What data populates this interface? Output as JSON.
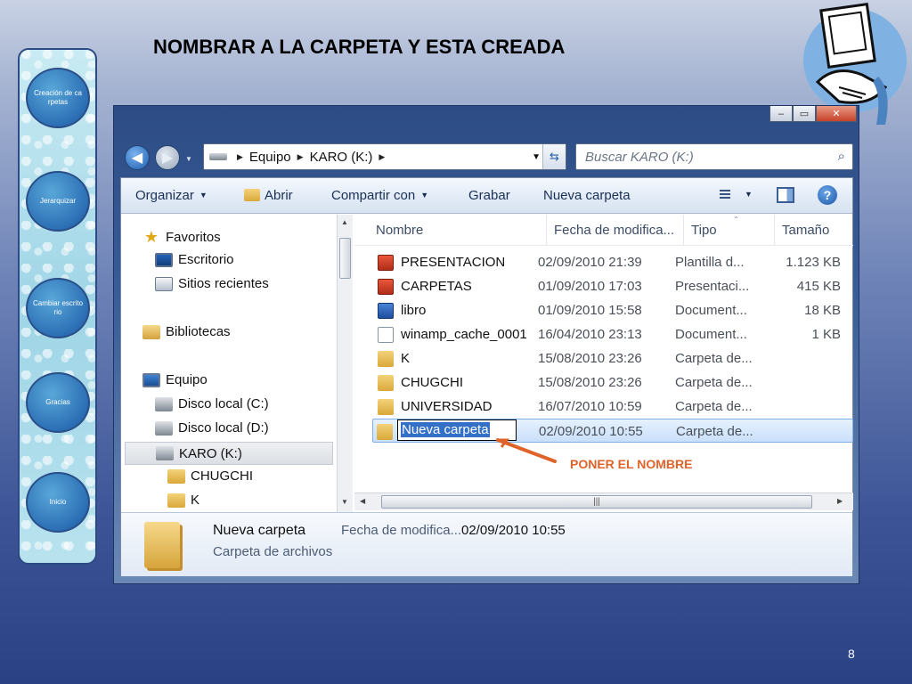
{
  "slide": {
    "title": "NOMBRAR A LA CARPETA Y ESTA CREADA",
    "page_number": "8",
    "annotation": "PONER EL NOMBRE",
    "annotation_color": "#e0632b"
  },
  "sidebar": {
    "items": [
      {
        "label": "Creación de carpetas"
      },
      {
        "label": "Jerarquizar"
      },
      {
        "label": "Cambiar escritorio"
      },
      {
        "label": "Gracias"
      },
      {
        "label": "Inicio"
      }
    ]
  },
  "window": {
    "controls": {
      "minimize": "–",
      "maximize": "▭",
      "close": "✕"
    },
    "address": {
      "segments": [
        "Equipo",
        "KARO (K:)"
      ]
    },
    "search": {
      "placeholder": "Buscar KARO (K:)"
    }
  },
  "toolbar": {
    "organize": "Organizar",
    "open": "Abrir",
    "share": "Compartir con",
    "burn": "Grabar",
    "new_folder": "Nueva carpeta"
  },
  "nav_pane": {
    "favorites": "Favoritos",
    "desktop": "Escritorio",
    "recent": "Sitios recientes",
    "libraries": "Bibliotecas",
    "computer": "Equipo",
    "disk_c": "Disco local (C:)",
    "disk_d": "Disco local (D:)",
    "drive_k": "KARO (K:)",
    "sub_chugchi": "CHUGCHI",
    "sub_k": "K"
  },
  "columns": {
    "name": "Nombre",
    "date": "Fecha de modifica...",
    "type": "Tipo",
    "size": "Tamaño"
  },
  "files": [
    {
      "name": "PRESENTACION",
      "date": "02/09/2010 21:39",
      "type": "Plantilla d...",
      "size": "1.123 KB",
      "icon": "ppt-template-icon"
    },
    {
      "name": "CARPETAS",
      "date": "01/09/2010 17:03",
      "type": "Presentaci...",
      "size": "415 KB",
      "icon": "ppt-icon"
    },
    {
      "name": "libro",
      "date": "01/09/2010 15:58",
      "type": "Document...",
      "size": "18 KB",
      "icon": "word-doc-icon"
    },
    {
      "name": "winamp_cache_0001",
      "date": "16/04/2010 23:13",
      "type": "Document...",
      "size": "1 KB",
      "icon": "generic-file-icon"
    },
    {
      "name": "K",
      "date": "15/08/2010 23:26",
      "type": "Carpeta de...",
      "size": "",
      "icon": "folder-icon"
    },
    {
      "name": "CHUGCHI",
      "date": "15/08/2010 23:26",
      "type": "Carpeta de...",
      "size": "",
      "icon": "folder-icon"
    },
    {
      "name": "UNIVERSIDAD",
      "date": "16/07/2010 10:59",
      "type": "Carpeta de...",
      "size": "",
      "icon": "folder-icon"
    },
    {
      "name": "Nueva carpeta",
      "date": "02/09/2010 10:55",
      "type": "Carpeta de...",
      "size": "",
      "icon": "folder-icon"
    }
  ],
  "details": {
    "name": "Nueva carpeta",
    "type": "Carpeta de archivos",
    "date_label": "Fecha de modifica...",
    "date_value": "02/09/2010 10:55"
  }
}
